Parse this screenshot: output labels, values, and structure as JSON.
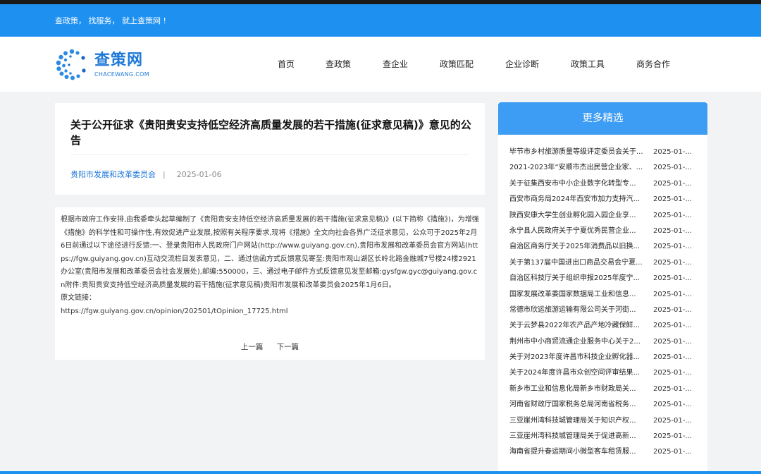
{
  "topbar": {
    "slogan": "查政策， 找服务， 就上查策网 !"
  },
  "brand": {
    "name_cn": "查策网",
    "name_en": "CHACEWANG.COM",
    "color": "#1e78d8"
  },
  "nav": {
    "items": [
      {
        "label": "首页"
      },
      {
        "label": "查政策"
      },
      {
        "label": "查企业"
      },
      {
        "label": "政策匹配"
      },
      {
        "label": "企业诊断"
      },
      {
        "label": "政策工具"
      },
      {
        "label": "商务合作"
      }
    ]
  },
  "article": {
    "title": "关于公开征求《贵阳贵安支持低空经济高质量发展的若干措施(征求意见稿)》意见的公告",
    "source": "贵阳市发展和改革委员会",
    "separator": "|",
    "date": "2025-01-06",
    "body": "根据市政府工作安排,由我委牵头起草编制了《贵阳贵安支持低空经济高质量发展的若干措施(征求意见稿)》(以下简称《措施》)，为增强《措施》的科学性和可操作性,有效促进产业发展,按照有关程序要求,现将《措施》全文向社会各界广泛征求意见，公众可于2025年2月6日前通过以下途径进行反馈:一、登录贵阳市人民政府门户网站(http://www.guiyang.gov.cn),贵阳市发展和改革委员会官方网站(https://fgw.guiyang.gov.cn)互动交流栏目发表意见，二、通过信函方式反馈意见寄至:贵阳市观山湖区长岭北路金融城7号楼24楼2921办公室(贵阳市发展和改革委员会社会发展处),邮编:550000，三、通过电子邮件方式反馈意见发至邮箱:gysfgw.gyc@guiyang.gov.cn附件:贵阳贵安支持低空经济高质量发展的若干措施(征求意见稿)贵阳市发展和改革委员会2025年1月6日。",
    "link_label": "原文链接：",
    "link_url": "https://fgw.guiyang.gov.cn/opinion/202501/tOpinion_17725.html",
    "prev_label": "上一篇",
    "next_label": "下一篇"
  },
  "sidebar": {
    "title": "更多精选",
    "items": [
      {
        "title": "毕节市乡村旅游质量等级评定委员会关于...",
        "date": "2025-01-..."
      },
      {
        "title": "2021-2023年“安顺市杰出民营企业家、...",
        "date": "2025-01-..."
      },
      {
        "title": "关于征集西安市中小企业数字化转型专...",
        "date": "2025-01-..."
      },
      {
        "title": "西安市商务局2024年西安市加力支持汽...",
        "date": "2025-01-..."
      },
      {
        "title": "陕西安康大学生创业孵化园入园企业享...",
        "date": "2025-01-..."
      },
      {
        "title": "永宁县人民政府关于宁夏优秀民营企业...",
        "date": "2025-01-..."
      },
      {
        "title": "自治区商务厅关于2025年消费品以旧换...",
        "date": "2025-01-..."
      },
      {
        "title": "关于第137届中国进出口商品交易会宁夏...",
        "date": "2025-01-..."
      },
      {
        "title": "自治区科技厅关于组织申报2025年度宁...",
        "date": "2025-01-..."
      },
      {
        "title": "国家发展改革委国家数据局工业和信息...",
        "date": "2025-01-..."
      },
      {
        "title": "常德市欣运旅游运输有限公司关于河街...",
        "date": "2025-01-..."
      },
      {
        "title": "关于云梦县2022年农产品产地冷藏保鲜...",
        "date": "2025-01-..."
      },
      {
        "title": "荆州市中小商贸流通企业服务中心关于2...",
        "date": "2025-01-..."
      },
      {
        "title": "关于对2023年度许昌市科技企业孵化器...",
        "date": "2025-01-..."
      },
      {
        "title": "关于2024年度许昌市众创空间评审结果...",
        "date": "2025-01-..."
      },
      {
        "title": "新乡市工业和信息化局新乡市财政局关...",
        "date": "2025-01-..."
      },
      {
        "title": "河南省财政厅国家税务总局河南省税务...",
        "date": "2025-01-..."
      },
      {
        "title": "三亚崖州湾科技城管理局关于知识产权...",
        "date": "2025-01-..."
      },
      {
        "title": "三亚崖州湾科技城管理局关于促进高新...",
        "date": "2025-01-..."
      },
      {
        "title": "海南省提升春运期间小微型客车租赁服...",
        "date": "2025-01-..."
      }
    ]
  }
}
